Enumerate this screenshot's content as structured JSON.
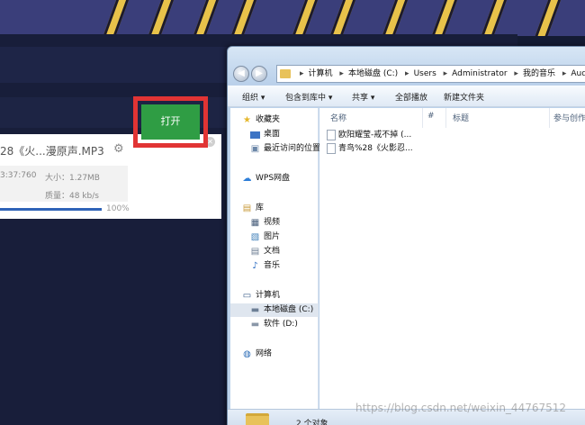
{
  "converter": {
    "file_name": "28《火...漫原声.MP3",
    "duration": "3:37:760",
    "size": "大小：1.27MB",
    "quality": "质量：48 kb/s",
    "progress_percent": 100,
    "progress_text": "100%",
    "open_label": "打开",
    "highlight_color": "#e13434",
    "button_color": "#2f9d44"
  },
  "explorer": {
    "breadcrumb": [
      "计算机",
      "本地磁盘 (C:)",
      "Users",
      "Administrator",
      "我的音乐",
      "AudioEd"
    ],
    "toolbar": [
      "组织 ▾",
      "包含到库中 ▾",
      "共享 ▾",
      "全部播放",
      "新建文件夹"
    ],
    "nav": {
      "favorites": "收藏夹",
      "desktop": "桌面",
      "recent": "最近访问的位置",
      "wps": "WPS网盘",
      "library": "库",
      "videos": "视频",
      "pictures": "图片",
      "documents": "文档",
      "music": "音乐",
      "computer": "计算机",
      "drive_c": "本地磁盘 (C:)",
      "drive_d": "软件 (D:)",
      "network": "网络"
    },
    "columns": {
      "name": "名称",
      "number": "#",
      "title": "标题",
      "artist": "参与创作"
    },
    "files": [
      "欧阳耀莹-戒不掉 (...",
      "青鸟%28《火影忍..."
    ],
    "status": "2 个对象"
  },
  "watermark": "https://blog.csdn.net/weixin_44767512"
}
